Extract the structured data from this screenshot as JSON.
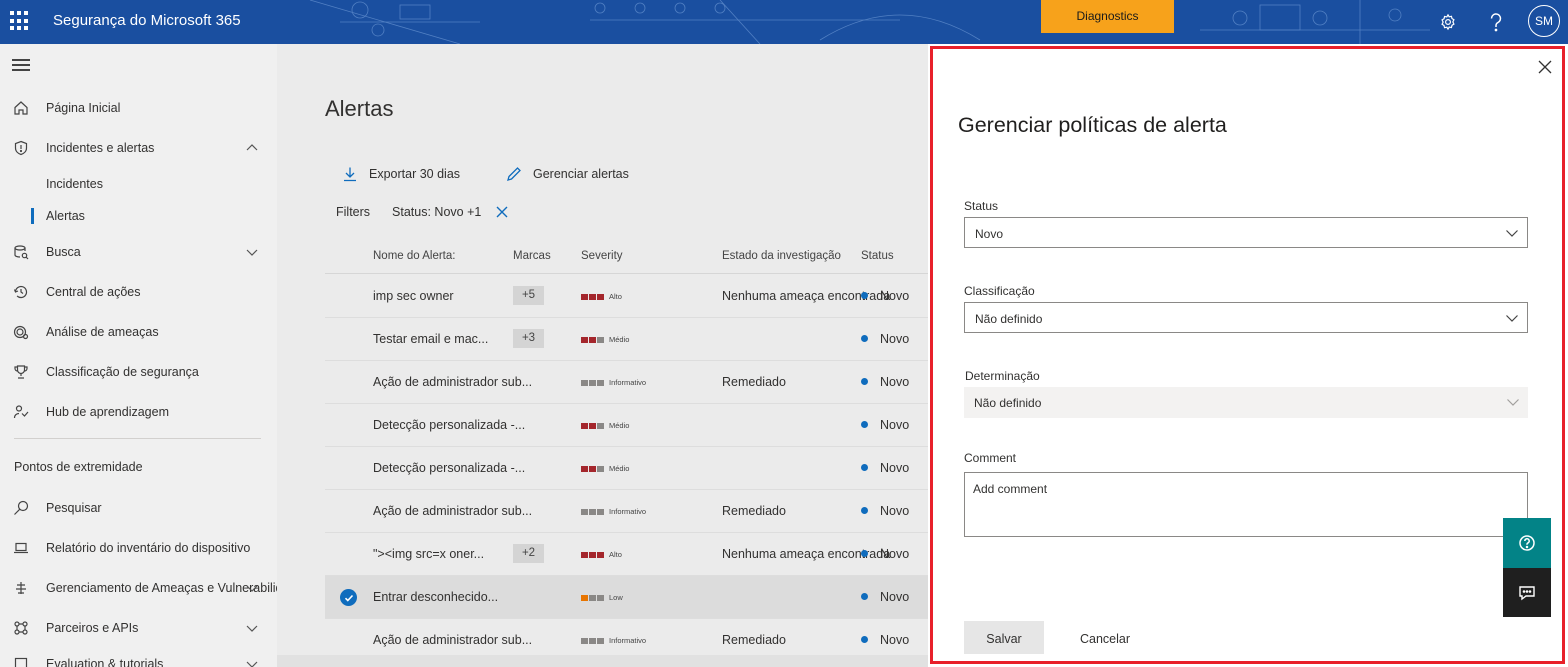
{
  "topbar": {
    "app_title": "Segurança do Microsoft 365",
    "diagnostics_label": "Diagnostics",
    "avatar_initials": "SM",
    "icons": [
      "waffle-icon",
      "gear-icon",
      "help-icon"
    ]
  },
  "nav": {
    "items": [
      {
        "label": "Página Inicial",
        "icon": "home-icon"
      },
      {
        "label": "Incidentes e alertas",
        "icon": "shield-icon",
        "chevron": "up"
      },
      {
        "label": "Busca",
        "icon": "hunting-icon",
        "chevron": "down"
      },
      {
        "label": "Central de ações",
        "icon": "action-center-icon"
      },
      {
        "label": "Análise de ameaças",
        "icon": "threat-analytics-icon"
      },
      {
        "label": "Classificação de segurança",
        "icon": "trophy-icon"
      },
      {
        "label": "Hub de aprendizagem",
        "icon": "learning-hub-icon"
      },
      {
        "label": "Pesquisar",
        "icon": "search-icon"
      },
      {
        "label": "Relatório do inventário do dispositivo",
        "icon": "laptop-icon"
      },
      {
        "label": "Gerenciamento de Ameaças e Vulnerabilidades",
        "icon": "tvm-icon",
        "chevron": "down"
      },
      {
        "label": "Parceiros e APIs",
        "icon": "partners-icon",
        "chevron": "down"
      },
      {
        "label": "Evaluation & tutorials",
        "icon": "evaluation-icon",
        "chevron": "down"
      }
    ],
    "subitems": [
      {
        "label": "Incidentes"
      },
      {
        "label": "Alertas",
        "selected": true
      }
    ],
    "section_label": "Pontos de extremidade"
  },
  "main": {
    "title": "Alertas",
    "commands": {
      "export_label": "Exportar 30 dias",
      "manage_label": "Gerenciar alertas"
    },
    "filters": {
      "label": "Filters",
      "status_chip": "Status: Novo +1"
    },
    "columns": [
      "Nome do Alerta:",
      "Marcas",
      "Severity",
      "Estado da investigação",
      "Status"
    ],
    "rows": [
      {
        "name": "imp sec owner",
        "tag": "+5",
        "severity": "Alto",
        "investigation": "Nenhuma ameaça encontrada",
        "status": "Novo"
      },
      {
        "name": "Testar email e mac...",
        "tag": "+3",
        "severity": "Médio",
        "investigation": "",
        "status": "Novo"
      },
      {
        "name": "Ação de administrador sub...",
        "tag": "",
        "severity": "Informativo",
        "investigation": "Remediado",
        "status": "Novo"
      },
      {
        "name": "Detecção personalizada -...",
        "tag": "",
        "severity": "Médio",
        "investigation": "",
        "status": "Novo"
      },
      {
        "name": "Detecção personalizada -...",
        "tag": "",
        "severity": "Médio",
        "investigation": "",
        "status": "Novo"
      },
      {
        "name": "Ação de administrador sub...",
        "tag": "",
        "severity": "Informativo",
        "investigation": "Remediado",
        "status": "Novo"
      },
      {
        "name": "\"><img src=x oner...",
        "tag": "+2",
        "severity": "Alto",
        "investigation": "Nenhuma ameaça encontrada",
        "status": "Novo"
      },
      {
        "name": "Entrar desconhecido...",
        "tag": "",
        "severity": "Low",
        "investigation": "",
        "status": "Novo",
        "selected": true
      },
      {
        "name": "Ação de administrador sub...",
        "tag": "",
        "severity": "Informativo",
        "investigation": "Remediado",
        "status": "Novo"
      }
    ]
  },
  "panel": {
    "title": "Gerenciar políticas de alerta",
    "status_label": "Status",
    "status_value": "Novo",
    "classification_label": "Classificação",
    "classification_value": "Não definido",
    "determination_label": "Determinação",
    "determination_value": "Não definido",
    "comment_label": "Comment",
    "comment_placeholder": "Add comment",
    "save_label": "Salvar",
    "cancel_label": "Cancelar"
  },
  "colors": {
    "topbar": "#1a4fa0",
    "diagnostics": "#f7a21b",
    "accent": "#0f6cbd",
    "highlight_border": "#e8202a",
    "severity_high": "#a4262c",
    "severity_low": "#e87500",
    "severity_info": "#8a8886",
    "help_button": "#038387"
  }
}
